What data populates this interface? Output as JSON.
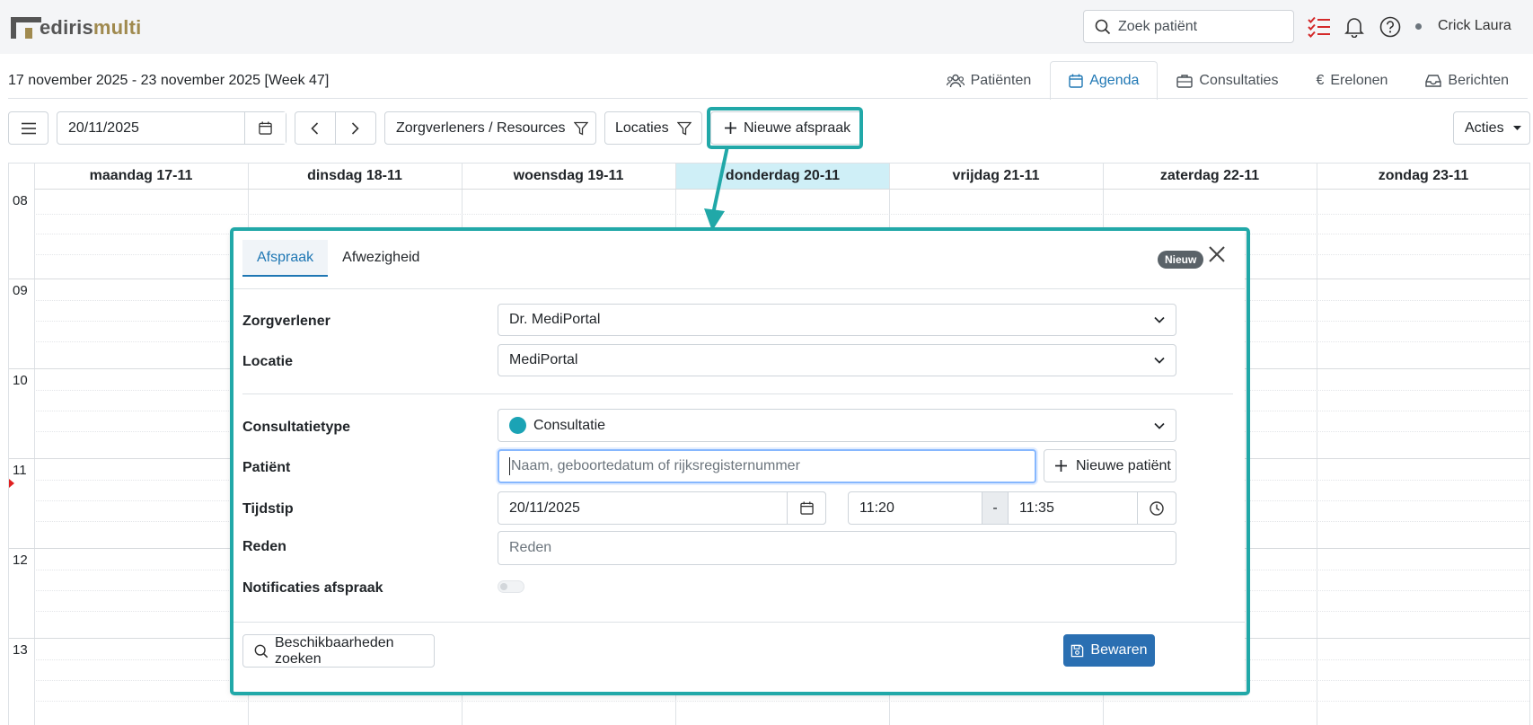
{
  "app": {
    "logo": {
      "part1": "ediris",
      "part2": "multi"
    },
    "search_placeholder": "Zoek patiënt",
    "user_name": "Crick Laura"
  },
  "header": {
    "week_title": "17 november 2025 - 23 november 2025 [Week 47]",
    "tabs": [
      {
        "label": "Patiënten",
        "icon": "users-icon"
      },
      {
        "label": "Agenda",
        "icon": "calendar-icon",
        "active": true
      },
      {
        "label": "Consultaties",
        "icon": "briefcase-icon"
      },
      {
        "label": "Erelonen",
        "icon": "euro-icon"
      },
      {
        "label": "Berichten",
        "icon": "inbox-icon"
      }
    ]
  },
  "toolbar": {
    "date_value": "20/11/2025",
    "providers_label": "Zorgverleners / Resources",
    "locations_label": "Locaties",
    "new_appointment_label": "Nieuwe afspraak",
    "actions_label": "Acties"
  },
  "calendar": {
    "days": [
      "maandag 17-11",
      "dinsdag 18-11",
      "woensdag 19-11",
      "donderdag 20-11",
      "vrijdag 21-11",
      "zaterdag 22-11",
      "zondag 23-11"
    ],
    "today_index": 3,
    "hours": [
      "08",
      "09",
      "10",
      "11",
      "12",
      "13"
    ]
  },
  "modal": {
    "tab_appointment": "Afspraak",
    "tab_absence": "Afwezigheid",
    "badge": "Nieuw",
    "provider_label": "Zorgverlener",
    "provider_value": "Dr. MediPortal",
    "location_label": "Locatie",
    "location_value": "MediPortal",
    "type_label": "Consultatietype",
    "type_value": "Consultatie",
    "type_color": "#1ba3b5",
    "patient_label": "Patiënt",
    "patient_placeholder": "Naam, geboortedatum of rijksregisternummer",
    "new_patient_label": "Nieuwe patiënt",
    "time_label": "Tijdstip",
    "date_value": "20/11/2025",
    "time_from": "11:20",
    "time_sep": "-",
    "time_to": "11:35",
    "reason_label": "Reden",
    "reason_placeholder": "Reden",
    "notifications_label": "Notificaties afspraak",
    "search_availability_label": "Beschikbaarheden zoeken",
    "save_label": "Bewaren"
  },
  "colors": {
    "accent": "#1f77b4",
    "highlight": "#21a8a8",
    "save": "#2a6fb2",
    "today": "#cfeff7"
  }
}
